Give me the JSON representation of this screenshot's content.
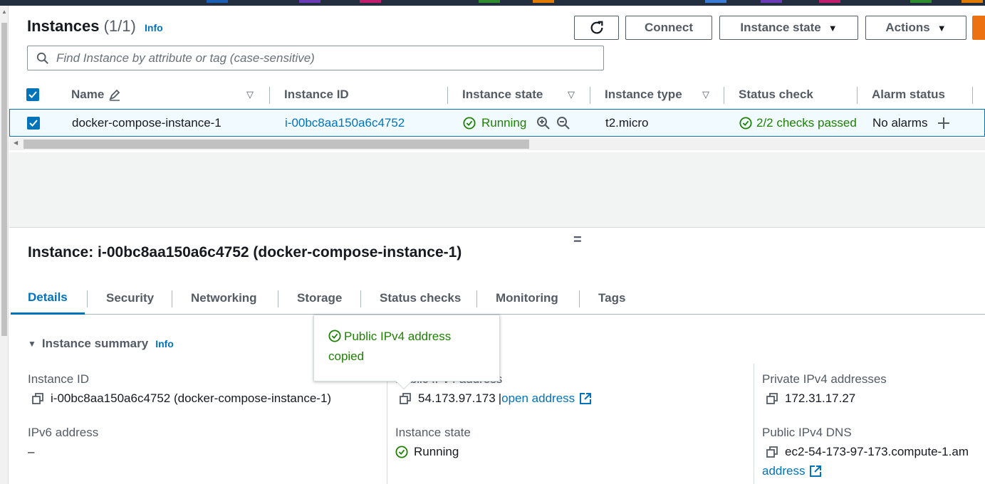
{
  "colors": {
    "accent": "#0073bb",
    "success": "#1d8102",
    "orange": "#ec7211"
  },
  "header": {
    "title": "Instances",
    "count": "(1/1)",
    "info": "Info",
    "buttons": {
      "refresh_icon": "refresh-icon",
      "connect": "Connect",
      "instance_state": "Instance state",
      "actions": "Actions"
    }
  },
  "search": {
    "placeholder": "Find Instance by attribute or tag (case-sensitive)"
  },
  "table": {
    "columns": [
      "Name",
      "Instance ID",
      "Instance state",
      "Instance type",
      "Status check",
      "Alarm status"
    ],
    "row": {
      "name": "docker-compose-instance-1",
      "instance_id": "i-00bc8aa150a6c4752",
      "state": "Running",
      "type": "t2.micro",
      "status_check": "2/2 checks passed",
      "alarm": "No alarms"
    }
  },
  "details": {
    "drag_handle": "=",
    "title": "Instance: i-00bc8aa150a6c4752 (docker-compose-instance-1)",
    "tabs": [
      "Details",
      "Security",
      "Networking",
      "Storage",
      "Status checks",
      "Monitoring",
      "Tags"
    ],
    "summary": {
      "header": "Instance summary",
      "info": "Info"
    },
    "fields": {
      "instance_id_label": "Instance ID",
      "instance_id_value": "i-00bc8aa150a6c4752 (docker-compose-instance-1)",
      "public_ipv4_label": "Public IPv4 address",
      "public_ipv4_value": "54.173.97.173",
      "open_address": "open address",
      "private_ipv4_label": "Private IPv4 addresses",
      "private_ipv4_value": "172.31.17.27",
      "ipv6_label": "IPv6 address",
      "ipv6_value": "–",
      "instance_state_label": "Instance state",
      "instance_state_value": "Running",
      "public_dns_label": "Public IPv4 DNS",
      "public_dns_value": "ec2-54-173-97-173.compute-1.am",
      "public_dns_link": "address"
    },
    "toast": "Public IPv4 address copied"
  }
}
